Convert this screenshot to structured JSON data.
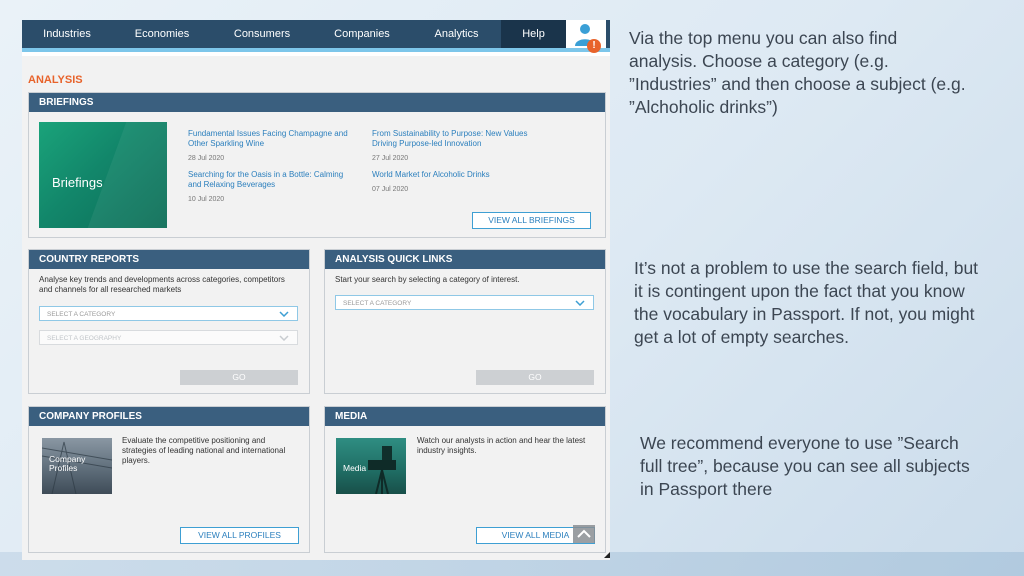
{
  "nav": {
    "items": [
      "Industries",
      "Economies",
      "Consumers",
      "Companies",
      "Analytics",
      "Help"
    ],
    "alert_badge": "!"
  },
  "analysis_label": "ANALYSIS",
  "briefings": {
    "header": "BRIEFINGS",
    "card_label": "Briefings",
    "articles": [
      {
        "title": "Fundamental Issues Facing Champagne and Other Sparkling Wine",
        "date": "28 Jul 2020"
      },
      {
        "title": "From Sustainability to Purpose: New Values Driving Purpose-led Innovation",
        "date": "27 Jul 2020"
      },
      {
        "title": "Searching for the Oasis in a Bottle: Calming and Relaxing Beverages",
        "date": "10 Jul 2020"
      },
      {
        "title": "World Market for Alcoholic Drinks",
        "date": "07 Jul 2020"
      }
    ],
    "view_all": "VIEW ALL BRIEFINGS"
  },
  "country_reports": {
    "header": "COUNTRY REPORTS",
    "description": "Analyse key trends and developments across categories, competitors and channels for all researched markets",
    "category_placeholder": "SELECT A CATEGORY",
    "geography_placeholder": "SELECT A GEOGRAPHY",
    "go": "GO"
  },
  "quick_links": {
    "header": "ANALYSIS QUICK LINKS",
    "description": "Start your search by selecting a category of interest.",
    "category_placeholder": "SELECT A CATEGORY",
    "go": "GO"
  },
  "company_profiles": {
    "header": "COMPANY PROFILES",
    "thumb_label": "Company Profiles",
    "description": "Evaluate the competitive positioning and strategies of leading national and international players.",
    "view_all": "VIEW ALL PROFILES"
  },
  "media": {
    "header": "MEDIA",
    "thumb_label": "Media",
    "description": "Watch our analysts in action and hear the latest industry insights.",
    "view_all": "VIEW ALL MEDIA"
  },
  "notes": [
    "Via the top menu you can also find analysis. Choose a category (e.g. ”Industries” and then choose a subject (e.g. ”Alchoholic drinks”)",
    "It’s not a problem to use the search field, but it is contingent upon the fact that you know the vocabulary in Passport. If not, you might get a lot of empty searches.",
    "We recommend everyone to use ”Search full tree”, because you can see all subjects in Passport there"
  ],
  "colors": {
    "nav_bg": "#2b4d6a",
    "panel_header": "#3a5f7f",
    "accent_orange": "#e8632b",
    "link_blue": "#2b7fbd",
    "briefings_green": "#12866a"
  }
}
